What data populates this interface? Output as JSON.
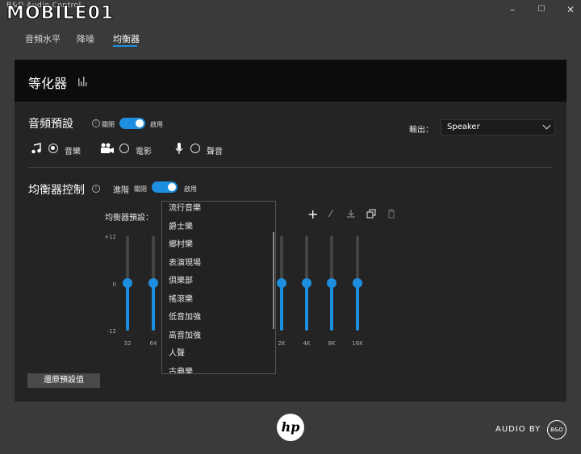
{
  "window": {
    "title": "B&O Audio Control",
    "watermark": "MOBILE01",
    "minimize": "–",
    "maximize": "☐",
    "close": "✕"
  },
  "tabs": [
    {
      "label": "音頻水平",
      "active": false
    },
    {
      "label": "降噪",
      "active": false
    },
    {
      "label": "均衡器",
      "active": true
    }
  ],
  "panel": {
    "title": "等化器"
  },
  "audio_preset": {
    "title": "音頻預設",
    "toggle_off": "關閉",
    "toggle_on": "啟用",
    "enabled": true,
    "output_label": "輸出：",
    "output_value": "Speaker",
    "modes": [
      {
        "label": "音樂",
        "icon": "music-icon",
        "selected": true
      },
      {
        "label": "電影",
        "icon": "video-camera-icon",
        "selected": false
      },
      {
        "label": "聲音",
        "icon": "microphone-icon",
        "selected": false
      }
    ]
  },
  "eq_control": {
    "title": "均衡器控制",
    "advanced_label": "進階",
    "toggle_off": "關閉",
    "toggle_on": "啟用",
    "enabled": true,
    "preset_label": "均衡器預設：",
    "axis": {
      "top": "+12",
      "mid": "0",
      "bottom": "-12"
    },
    "bands": [
      {
        "freq": "32",
        "value": 0
      },
      {
        "freq": "64",
        "value": 0
      },
      {
        "freq": "2K",
        "value": 0
      },
      {
        "freq": "4K",
        "value": 0
      },
      {
        "freq": "8K",
        "value": 0
      },
      {
        "freq": "16K",
        "value": 0
      }
    ],
    "preset_options": [
      "流行音樂",
      "爵士樂",
      "鄉村樂",
      "表演現場",
      "俱樂部",
      "搖滾樂",
      "低音加強",
      "高音加強",
      "人聲",
      "古典樂"
    ],
    "reset_label": "還原預設值"
  },
  "footer": {
    "hp_logo": "hp",
    "audio_by": "AUDIO BY",
    "bo_logo": "B&O"
  },
  "colors": {
    "accent": "#1e8fe0",
    "panel": "#242424",
    "header": "#0c0c0c",
    "background": "#3a3a3a"
  }
}
